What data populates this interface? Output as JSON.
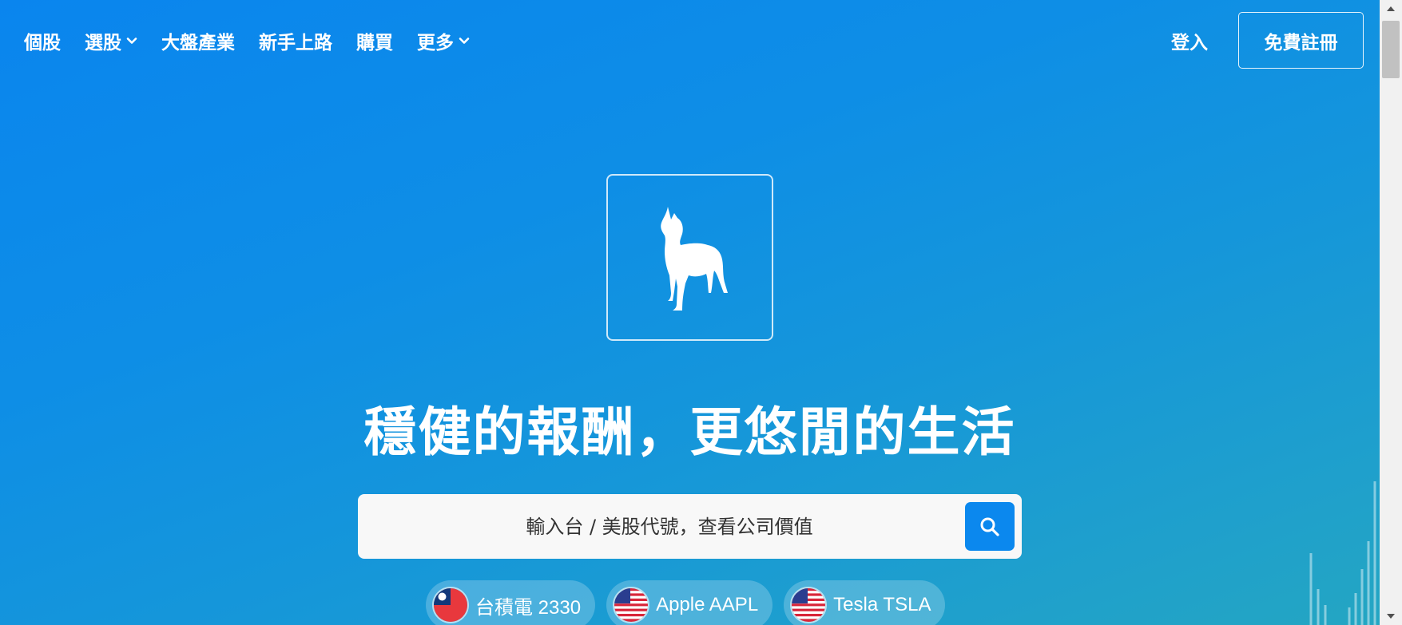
{
  "nav": {
    "items": [
      {
        "label": "個股",
        "has_dropdown": false
      },
      {
        "label": "選股",
        "has_dropdown": true
      },
      {
        "label": "大盤產業",
        "has_dropdown": false
      },
      {
        "label": "新手上路",
        "has_dropdown": false
      },
      {
        "label": "購買",
        "has_dropdown": false
      },
      {
        "label": "更多",
        "has_dropdown": true
      }
    ],
    "login_label": "登入",
    "register_label": "免費註冊"
  },
  "hero": {
    "logo_icon": "dog-logo-icon",
    "headline": "穩健的報酬，更悠閒的生活"
  },
  "search": {
    "placeholder": "輸入台 / 美股代號，查看公司價值",
    "button_icon": "search-icon"
  },
  "quick_links": [
    {
      "label": "台積電 2330",
      "flag": "taiwan-flag-icon"
    },
    {
      "label": "Apple AAPL",
      "flag": "us-flag-icon"
    },
    {
      "label": "Tesla TSLA",
      "flag": "us-flag-icon"
    }
  ],
  "colors": {
    "background_start": "#0a85ee",
    "background_end": "#24a6c2",
    "search_button": "#0b88ee",
    "search_bg": "#f8f8f8"
  }
}
